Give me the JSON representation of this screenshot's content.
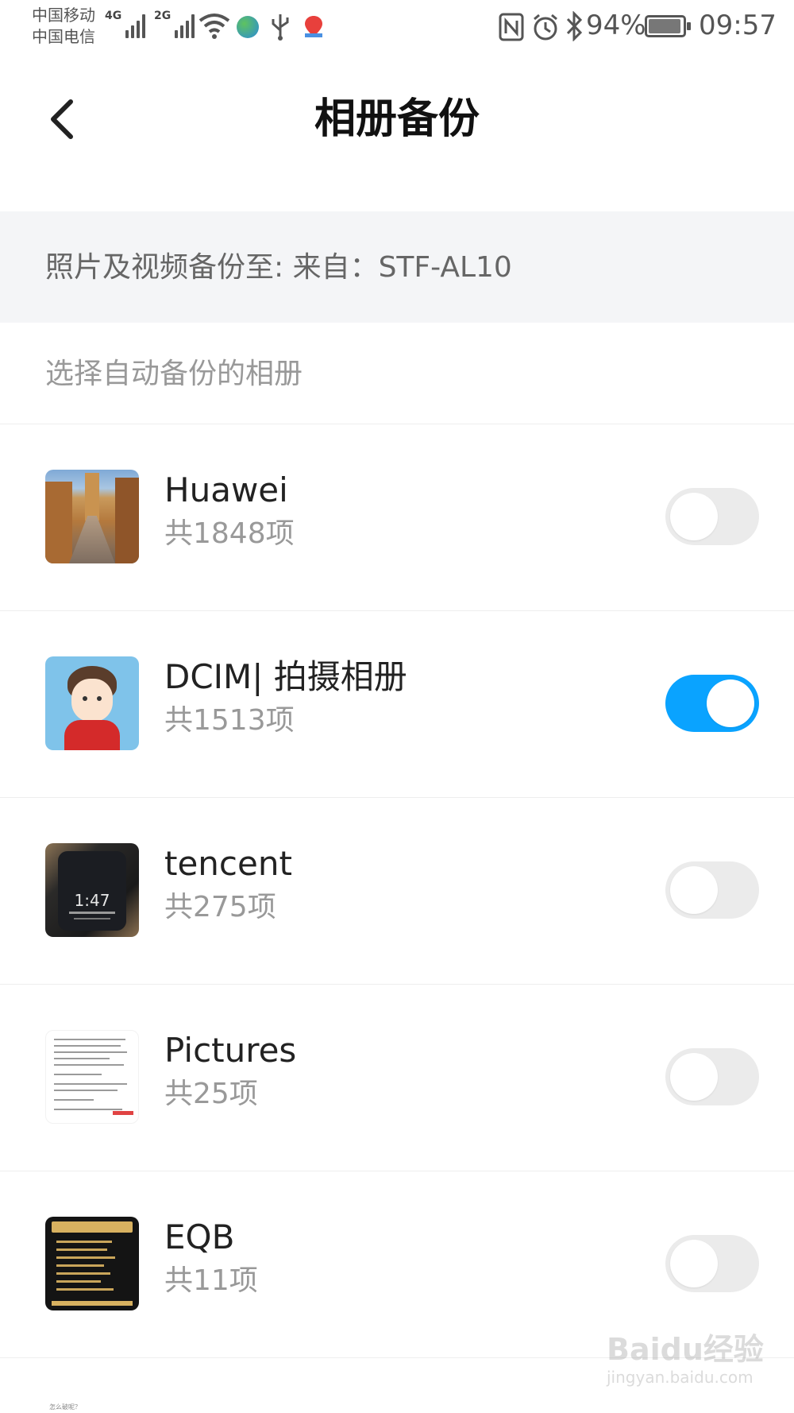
{
  "status_bar": {
    "carrier_1": "中国移动",
    "carrier_2": "中国电信",
    "net_1": "4G",
    "net_2": "2G",
    "battery": "94%",
    "time": "09:57",
    "icons": [
      "signal-icon",
      "signal-icon",
      "wifi-icon",
      "globe-app-icon",
      "usb-icon",
      "map-app-icon",
      "nfc-icon",
      "alarm-icon",
      "bluetooth-icon",
      "battery-icon"
    ]
  },
  "header": {
    "back_icon": "back-arrow-icon",
    "title": "相册备份"
  },
  "info": {
    "text": "照片及视频备份至:  来自：STF-AL10"
  },
  "section": {
    "label": "选择自动备份的相册"
  },
  "albums": [
    {
      "name": "Huawei",
      "count": "共1848项",
      "enabled": false,
      "thumb": "street-photo"
    },
    {
      "name": "DCIM| 拍摄相册",
      "count": "共1513项",
      "enabled": true,
      "thumb": "cartoon-avatar"
    },
    {
      "name": "tencent",
      "count": "共275项",
      "enabled": false,
      "thumb": "phone-lockscreen-photo",
      "thumb_text": "1:47"
    },
    {
      "name": "Pictures",
      "count": "共25项",
      "enabled": false,
      "thumb": "document-scan"
    },
    {
      "name": "EQB",
      "count": "共11项",
      "enabled": false,
      "thumb": "promo-poster"
    }
  ],
  "partial_next": {
    "text": "怎么破呢？"
  },
  "watermark": {
    "logo": "Baidu经验",
    "url": "jingyan.baidu.com"
  },
  "colors": {
    "accent": "#0aa3ff",
    "toggle_off": "#ebebeb",
    "band": "#f4f5f7",
    "divider": "#eeeeee"
  }
}
